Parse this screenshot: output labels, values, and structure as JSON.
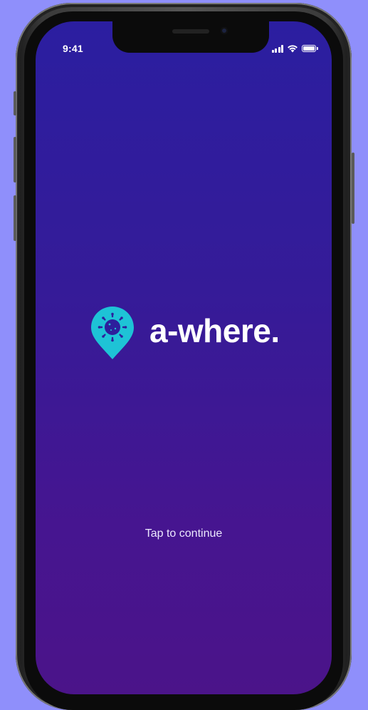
{
  "status_bar": {
    "time": "9:41",
    "icons": [
      "signal-icon",
      "wifi-icon",
      "battery-icon"
    ]
  },
  "logo": {
    "brand_name": "a-where.",
    "icon": "location-pin-icon",
    "pin_color": "#1ec3d6"
  },
  "main": {
    "tap_label": "Tap to continue"
  },
  "colors": {
    "background_top": "#2b1ea0",
    "background_bottom": "#4b1489",
    "outside_background": "#8f8ffb",
    "text": "#ffffff"
  }
}
